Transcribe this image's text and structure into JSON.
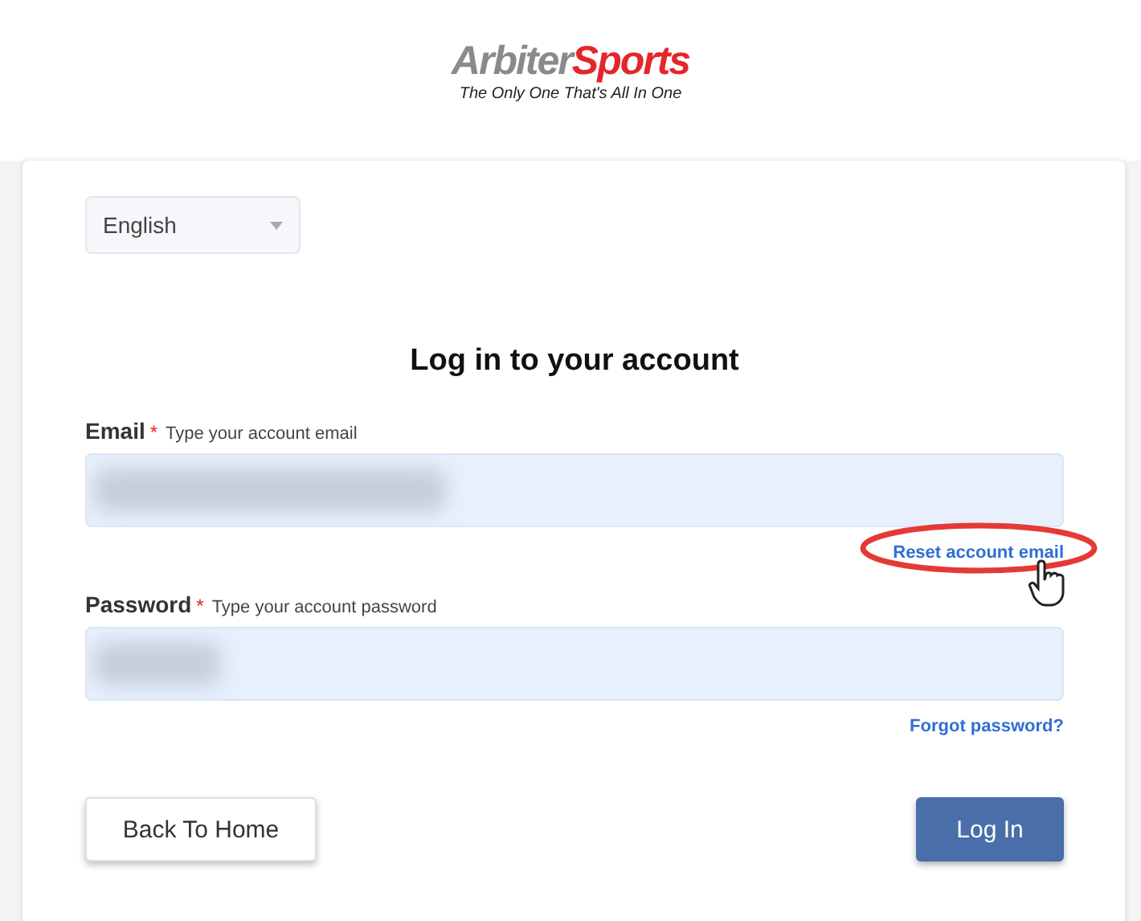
{
  "logo": {
    "part_1": "Arbiter",
    "part_2": "Sports",
    "tagline": "The Only One That's All In One"
  },
  "language": {
    "value": "English"
  },
  "title": "Log in to your account",
  "email": {
    "label": "Email",
    "required_mark": "*",
    "hint": "Type your account email",
    "redacted": true,
    "link": "Reset account email",
    "highlighted": true
  },
  "password": {
    "label": "Password",
    "required_mark": "*",
    "hint": "Type your account password",
    "redacted": true,
    "link": "Forgot password?"
  },
  "buttons": [
    {
      "label": "Back To Home",
      "kind": "secondary"
    },
    {
      "label": "Log In",
      "kind": "primary"
    }
  ]
}
